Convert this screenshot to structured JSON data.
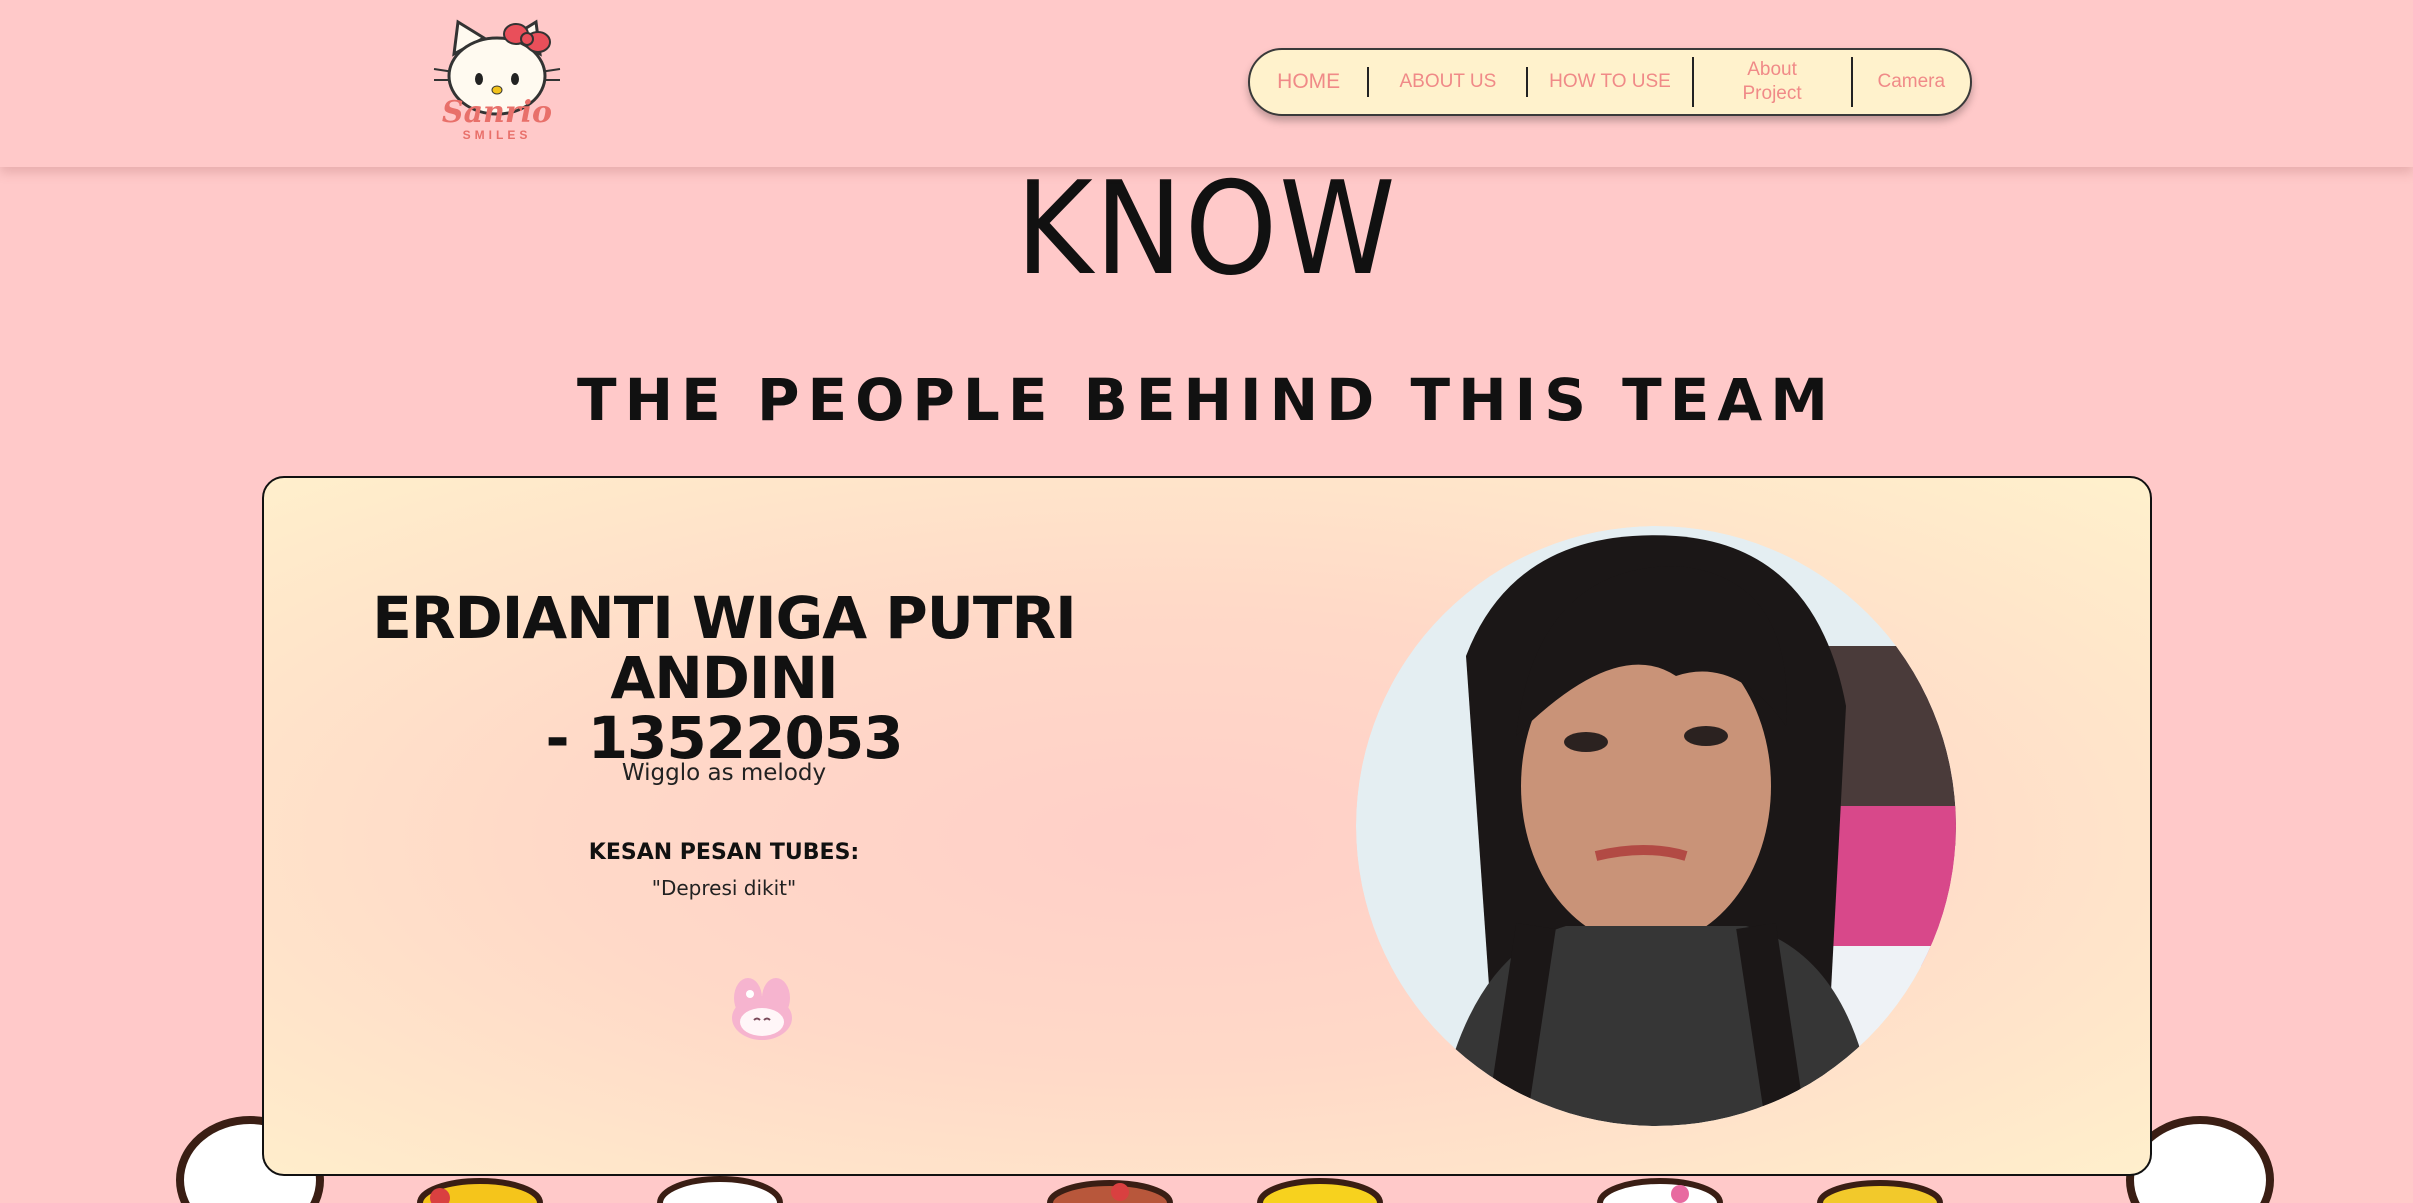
{
  "logo": {
    "text": "Sanrio",
    "subtext": "SMILES",
    "icon": "hello-kitty-icon"
  },
  "nav": {
    "items": [
      {
        "label": "HOME"
      },
      {
        "label": "ABOUT US"
      },
      {
        "label": "HOW TO USE"
      },
      {
        "label_line1": "About",
        "label_line2": "Project"
      },
      {
        "label": "Camera"
      }
    ]
  },
  "page": {
    "heading": "KNOW",
    "subheading": "THE PEOPLE BEHIND THIS TEAM"
  },
  "member": {
    "name_line1": "ERDIANTI WIGA PUTRI ANDINI",
    "name_line2": "- 13522053",
    "role": "Wigglo as melody",
    "kesan_label": "KESAN PESAN TUBES:",
    "kesan_text": "\"Depresi dikit\"",
    "icon": "my-melody-icon",
    "photo": "member-photo"
  },
  "colors": {
    "background": "#ffc9c9",
    "nav_background": "#fff2cc",
    "nav_text": "#f08a88",
    "logo_text": "#e8706a"
  }
}
